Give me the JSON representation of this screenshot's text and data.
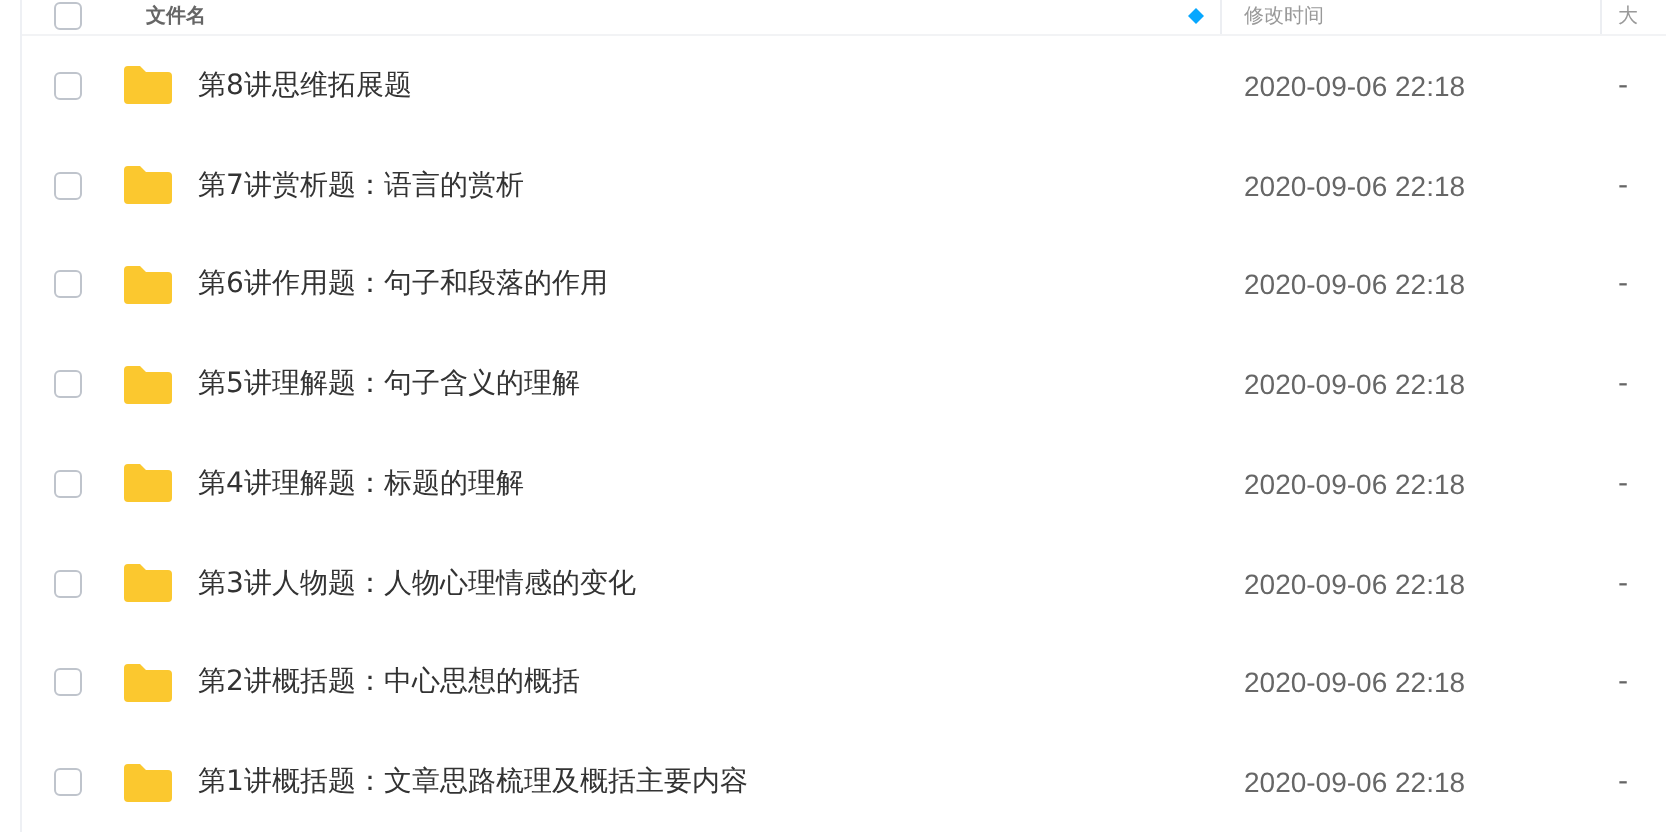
{
  "table": {
    "header_checkbox": {
      "checked": false
    },
    "columns": [
      {
        "label": "文件名",
        "sorted": true
      },
      {
        "label": "修改时间",
        "sorted": false
      },
      {
        "label": "大",
        "sorted": false
      }
    ],
    "rows": [
      {
        "checked": false,
        "name": "第8讲思维拓展题",
        "modified": "2020-09-06 22:18",
        "size": "-"
      },
      {
        "checked": false,
        "name": "第7讲赏析题：语言的赏析",
        "modified": "2020-09-06 22:18",
        "size": "-"
      },
      {
        "checked": false,
        "name": "第6讲作用题：句子和段落的作用",
        "modified": "2020-09-06 22:18",
        "size": "-"
      },
      {
        "checked": false,
        "name": "第5讲理解题：句子含义的理解",
        "modified": "2020-09-06 22:18",
        "size": "-"
      },
      {
        "checked": false,
        "name": "第4讲理解题：标题的理解",
        "modified": "2020-09-06 22:18",
        "size": "-"
      },
      {
        "checked": false,
        "name": "第3讲人物题：人物心理情感的变化",
        "modified": "2020-09-06 22:18",
        "size": "-"
      },
      {
        "checked": false,
        "name": "第2讲概括题：中心思想的概括",
        "modified": "2020-09-06 22:18",
        "size": "-"
      },
      {
        "checked": false,
        "name": "第1讲概括题：文章思路梳理及概括主要内容",
        "modified": "2020-09-06 22:18",
        "size": "-"
      }
    ]
  }
}
